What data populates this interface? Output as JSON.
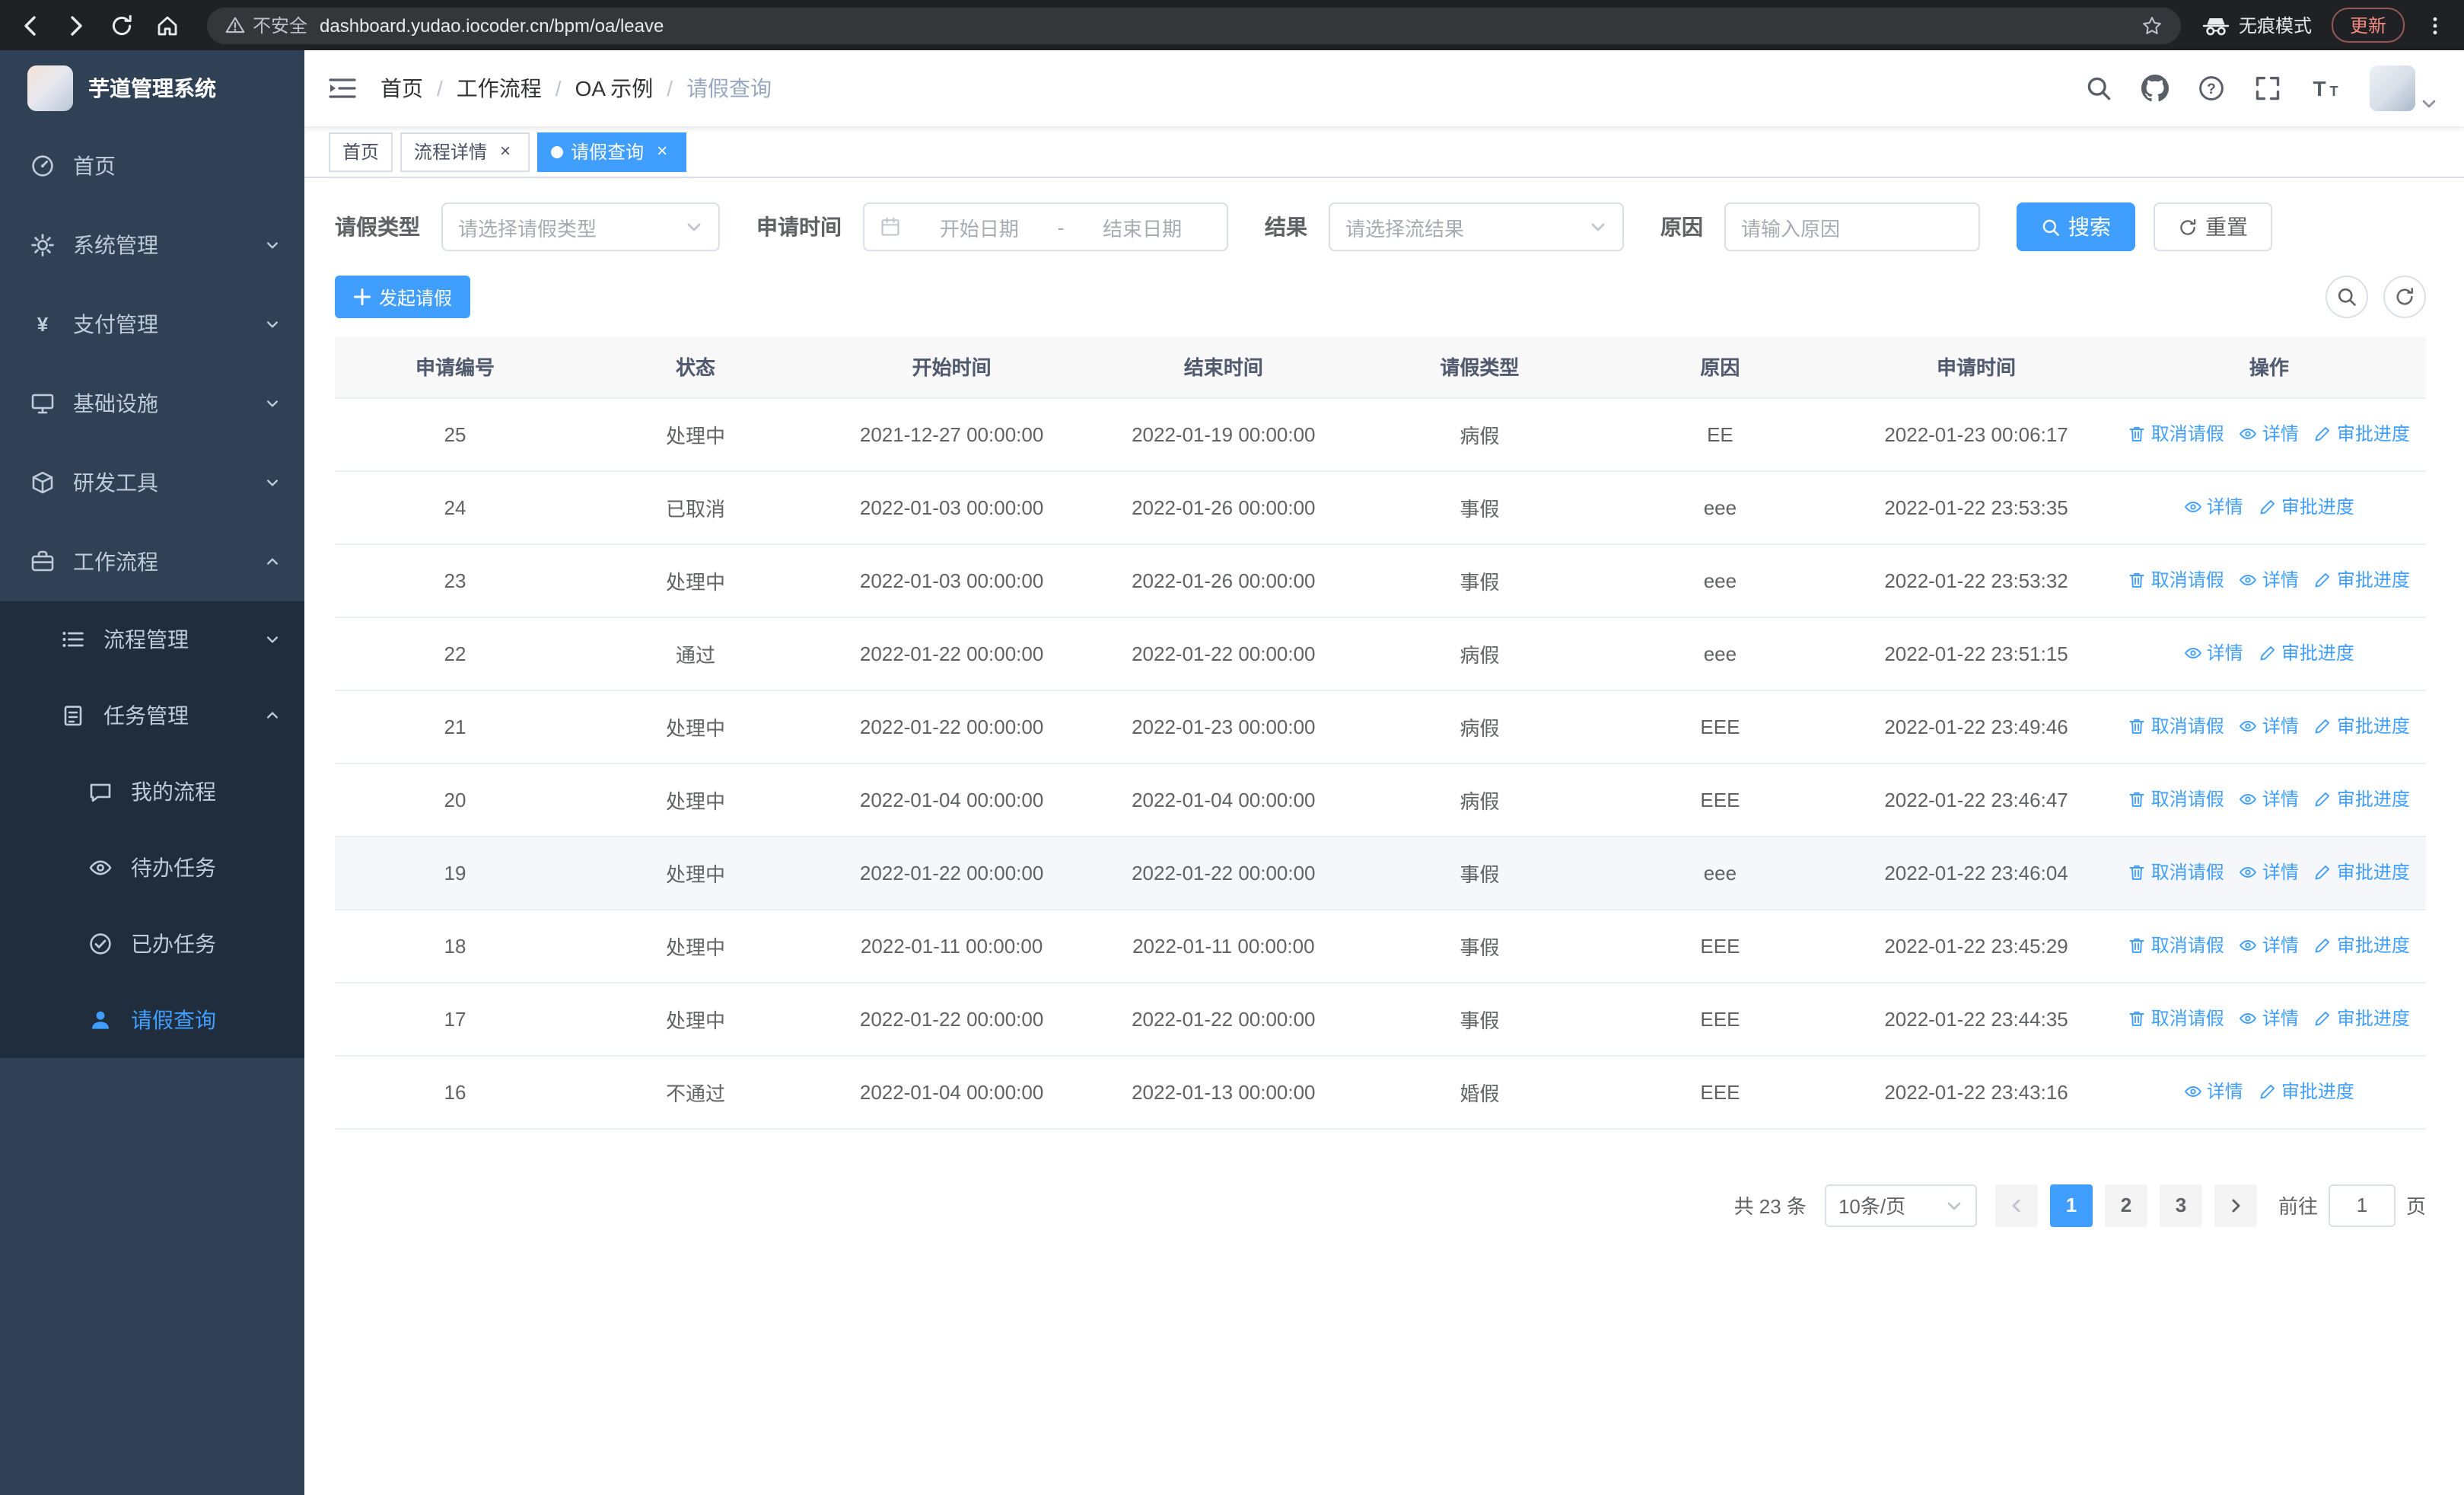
{
  "colors": {
    "accent": "#409eff",
    "sidebar_bg": "#304156",
    "submenu_bg": "#1f2d3d",
    "chrome_bg": "#202124",
    "link": "#409eff"
  },
  "browser": {
    "security_label": "不安全",
    "url": "dashboard.yudao.iocoder.cn/bpm/oa/leave",
    "incognito_label": "无痕模式",
    "update_label": "更新"
  },
  "sidebar": {
    "logo_title": "芋道管理系统",
    "items": [
      {
        "label": "首页",
        "icon": "dashboard-icon",
        "level": 1
      },
      {
        "label": "系统管理",
        "icon": "gear-icon",
        "level": 1,
        "arrow": "down"
      },
      {
        "label": "支付管理",
        "icon": "yen-icon",
        "level": 1,
        "arrow": "down"
      },
      {
        "label": "基础设施",
        "icon": "monitor-icon",
        "level": 1,
        "arrow": "down"
      },
      {
        "label": "研发工具",
        "icon": "toolbox-icon",
        "level": 1,
        "arrow": "down"
      },
      {
        "label": "工作流程",
        "icon": "briefcase-icon",
        "level": 1,
        "arrow": "up"
      },
      {
        "label": "流程管理",
        "icon": "list-icon",
        "level": 2,
        "arrow": "down"
      },
      {
        "label": "任务管理",
        "icon": "tasks-icon",
        "level": 2,
        "arrow": "up"
      },
      {
        "label": "我的流程",
        "icon": "chat-icon",
        "level": 3
      },
      {
        "label": "待办任务",
        "icon": "eye-icon",
        "level": 3
      },
      {
        "label": "已办任务",
        "icon": "check-circle-icon",
        "level": 3
      },
      {
        "label": "请假查询",
        "icon": "user-icon",
        "level": 3,
        "active": true
      }
    ]
  },
  "header": {
    "breadcrumb": [
      "首页",
      "工作流程",
      "OA 示例",
      "请假查询"
    ]
  },
  "tabs": [
    {
      "label": "首页",
      "closable": false,
      "active": false
    },
    {
      "label": "流程详情",
      "closable": true,
      "active": false
    },
    {
      "label": "请假查询",
      "closable": true,
      "active": true
    }
  ],
  "filters": {
    "leave_type": {
      "label": "请假类型",
      "placeholder": "请选择请假类型"
    },
    "apply_time": {
      "label": "申请时间",
      "start_placeholder": "开始日期",
      "separator": "-",
      "end_placeholder": "结束日期"
    },
    "result": {
      "label": "结果",
      "placeholder": "请选择流结果"
    },
    "reason": {
      "label": "原因",
      "placeholder": "请输入原因"
    },
    "search_label": "搜索",
    "reset_label": "重置"
  },
  "toolbar": {
    "create_label": "发起请假"
  },
  "table": {
    "columns": [
      "申请编号",
      "状态",
      "开始时间",
      "结束时间",
      "请假类型",
      "原因",
      "申请时间",
      "操作"
    ],
    "action_labels": {
      "cancel": "取消请假",
      "detail": "详情",
      "progress": "审批进度"
    },
    "rows": [
      {
        "id": "25",
        "status": "处理中",
        "start": "2021-12-27 00:00:00",
        "end": "2022-01-19 00:00:00",
        "type": "病假",
        "reason": "EE",
        "apply": "2022-01-23 00:06:17",
        "actions": [
          "cancel",
          "detail",
          "progress"
        ],
        "highlight": false
      },
      {
        "id": "24",
        "status": "已取消",
        "start": "2022-01-03 00:00:00",
        "end": "2022-01-26 00:00:00",
        "type": "事假",
        "reason": "eee",
        "apply": "2022-01-22 23:53:35",
        "actions": [
          "detail",
          "progress"
        ],
        "highlight": false
      },
      {
        "id": "23",
        "status": "处理中",
        "start": "2022-01-03 00:00:00",
        "end": "2022-01-26 00:00:00",
        "type": "事假",
        "reason": "eee",
        "apply": "2022-01-22 23:53:32",
        "actions": [
          "cancel",
          "detail",
          "progress"
        ],
        "highlight": false
      },
      {
        "id": "22",
        "status": "通过",
        "start": "2022-01-22 00:00:00",
        "end": "2022-01-22 00:00:00",
        "type": "病假",
        "reason": "eee",
        "apply": "2022-01-22 23:51:15",
        "actions": [
          "detail",
          "progress"
        ],
        "highlight": false
      },
      {
        "id": "21",
        "status": "处理中",
        "start": "2022-01-22 00:00:00",
        "end": "2022-01-23 00:00:00",
        "type": "病假",
        "reason": "EEE",
        "apply": "2022-01-22 23:49:46",
        "actions": [
          "cancel",
          "detail",
          "progress"
        ],
        "highlight": false
      },
      {
        "id": "20",
        "status": "处理中",
        "start": "2022-01-04 00:00:00",
        "end": "2022-01-04 00:00:00",
        "type": "病假",
        "reason": "EEE",
        "apply": "2022-01-22 23:46:47",
        "actions": [
          "cancel",
          "detail",
          "progress"
        ],
        "highlight": false
      },
      {
        "id": "19",
        "status": "处理中",
        "start": "2022-01-22 00:00:00",
        "end": "2022-01-22 00:00:00",
        "type": "事假",
        "reason": "eee",
        "apply": "2022-01-22 23:46:04",
        "actions": [
          "cancel",
          "detail",
          "progress"
        ],
        "highlight": true
      },
      {
        "id": "18",
        "status": "处理中",
        "start": "2022-01-11 00:00:00",
        "end": "2022-01-11 00:00:00",
        "type": "事假",
        "reason": "EEE",
        "apply": "2022-01-22 23:45:29",
        "actions": [
          "cancel",
          "detail",
          "progress"
        ],
        "highlight": false
      },
      {
        "id": "17",
        "status": "处理中",
        "start": "2022-01-22 00:00:00",
        "end": "2022-01-22 00:00:00",
        "type": "事假",
        "reason": "EEE",
        "apply": "2022-01-22 23:44:35",
        "actions": [
          "cancel",
          "detail",
          "progress"
        ],
        "highlight": false
      },
      {
        "id": "16",
        "status": "不通过",
        "start": "2022-01-04 00:00:00",
        "end": "2022-01-13 00:00:00",
        "type": "婚假",
        "reason": "EEE",
        "apply": "2022-01-22 23:43:16",
        "actions": [
          "detail",
          "progress"
        ],
        "highlight": false
      }
    ]
  },
  "pagination": {
    "total": "共 23 条",
    "page_size": "10条/页",
    "pages": [
      "1",
      "2",
      "3"
    ],
    "active_page": "1",
    "goto_label": "前往",
    "goto_value": "1",
    "unit_label": "页"
  }
}
